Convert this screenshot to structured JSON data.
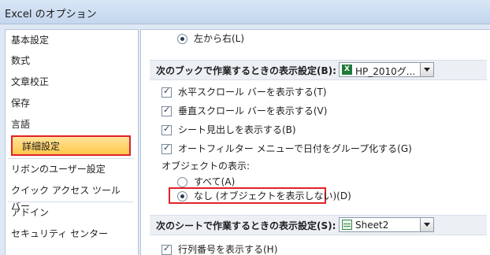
{
  "window": {
    "title": "Excel のオプション"
  },
  "sidebar": {
    "items": [
      {
        "label": "基本設定"
      },
      {
        "label": "数式"
      },
      {
        "label": "文章校正"
      },
      {
        "label": "保存"
      },
      {
        "label": "言語"
      },
      {
        "label": "詳細設定",
        "selected": true
      },
      {
        "label": "リボンのユーザー設定"
      },
      {
        "label": "クイック アクセス ツール バー"
      },
      {
        "label": "アドイン"
      },
      {
        "label": "セキュリティ センター"
      }
    ]
  },
  "content": {
    "direction_option": {
      "label": "左から右(L)",
      "selected": true
    },
    "workbook_section": {
      "heading": "次のブックで作業するときの表示設定(B):",
      "workbook_value": "HP_2010グ...",
      "checkboxes": [
        {
          "label": "水平スクロール バーを表示する(T)",
          "checked": true
        },
        {
          "label": "垂直スクロール バーを表示する(V)",
          "checked": true
        },
        {
          "label": "シート見出しを表示する(B)",
          "checked": true
        },
        {
          "label": "オートフィルター メニューで日付をグループ化する(G)",
          "checked": true
        }
      ],
      "objects_label": "オブジェクトの表示:",
      "object_options": [
        {
          "label": "すべて(A)",
          "selected": false
        },
        {
          "label": "なし (オブジェクトを表示しない)(D)",
          "selected": true
        }
      ]
    },
    "sheet_section": {
      "heading": "次のシートで作業するときの表示設定(S):",
      "sheet_value": "Sheet2",
      "checkboxes": [
        {
          "label": "行列番号を表示する(H)",
          "checked": true
        }
      ]
    }
  },
  "colors": {
    "highlight_border": "#e0222a",
    "selected_nav": "#ffd35a"
  }
}
